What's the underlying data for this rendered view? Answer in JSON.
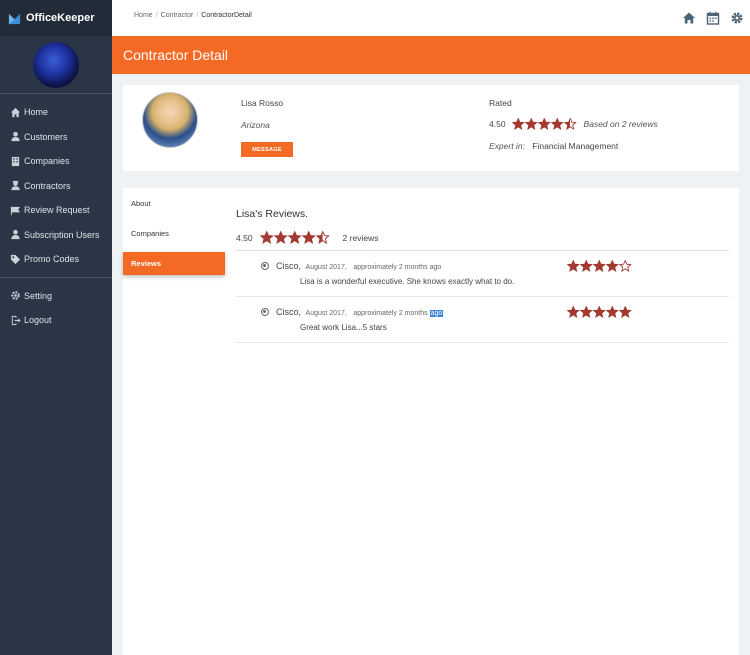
{
  "brand": {
    "name": "OfficeKeeper",
    "accent": "#3b8fd9"
  },
  "sidebar": {
    "items": [
      {
        "label": "Home",
        "icon": "home-icon"
      },
      {
        "label": "Customers",
        "icon": "user-icon"
      },
      {
        "label": "Companies",
        "icon": "building-icon"
      },
      {
        "label": "Contractors",
        "icon": "contractor-icon"
      },
      {
        "label": "Review Request",
        "icon": "flag-icon"
      },
      {
        "label": "Subscription Users",
        "icon": "user-icon"
      },
      {
        "label": "Promo Codes",
        "icon": "tag-icon"
      }
    ],
    "bottom_items": [
      {
        "label": "Setting",
        "icon": "gear-icon"
      },
      {
        "label": "Logout",
        "icon": "logout-icon"
      }
    ]
  },
  "breadcrumb": {
    "items": [
      "Home",
      "Contractor",
      "ContractorDetail"
    ]
  },
  "header": {
    "title": "Contractor Detail",
    "color": "#f46a25"
  },
  "profile": {
    "name": "Lisa Rosso",
    "location": "Arizona",
    "message_button": "MESSAGE",
    "rated_label": "Rated",
    "rating": "4.50",
    "rating_value": 4.5,
    "based_on": "Based on 2 reviews",
    "expert_label": "Expert in:",
    "expert_value": "Financial Management"
  },
  "tabs": [
    {
      "label": "About"
    },
    {
      "label": "Companies"
    },
    {
      "label": "Reviews",
      "active": true
    }
  ],
  "reviews": {
    "title": "Lisa's Reviews.",
    "average": "4.50",
    "average_value": 4.5,
    "count_label": "2 reviews",
    "items": [
      {
        "author": "Cisco,",
        "date": "August 2017,",
        "ago_prefix": "approximately 2 months ago",
        "ago_highlight": "",
        "text": "Lisa is a wonderful executive. She knows exactly what to do.",
        "stars": 4
      },
      {
        "author": "Cisco,",
        "date": "August 2017,",
        "ago_prefix": "approximately 2 months",
        "ago_highlight": "ago",
        "text": "Great work Lisa...5 stars",
        "stars": 5
      }
    ]
  },
  "colors": {
    "star": "#a23a32",
    "sidebar_bg": "#2a3545",
    "header_bg": "#f46a25"
  }
}
